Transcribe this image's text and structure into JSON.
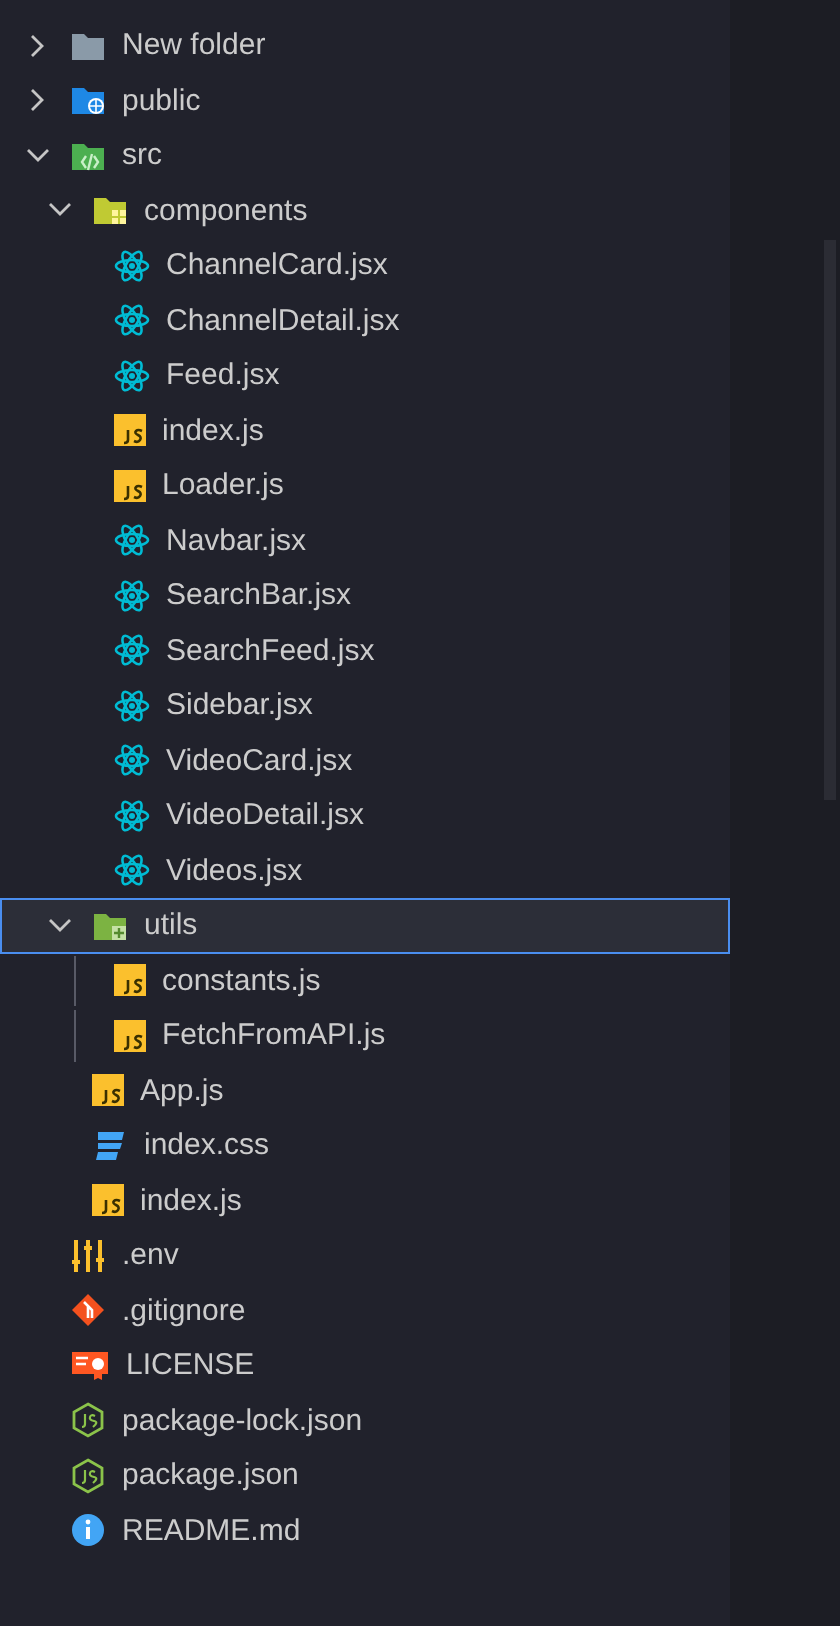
{
  "tree": [
    {
      "label": "New folder",
      "kind": "folder",
      "expanded": false,
      "selected": false
    },
    {
      "label": "public",
      "kind": "folder-public",
      "expanded": false,
      "selected": false
    },
    {
      "label": "src",
      "kind": "folder-src",
      "expanded": true,
      "selected": false,
      "children": [
        {
          "label": "components",
          "kind": "folder-components",
          "expanded": true,
          "selected": false,
          "children": [
            {
              "label": "ChannelCard.jsx",
              "kind": "react",
              "selected": false
            },
            {
              "label": "ChannelDetail.jsx",
              "kind": "react",
              "selected": false
            },
            {
              "label": "Feed.jsx",
              "kind": "react",
              "selected": false
            },
            {
              "label": "index.js",
              "kind": "js",
              "selected": false
            },
            {
              "label": "Loader.js",
              "kind": "js",
              "selected": false
            },
            {
              "label": "Navbar.jsx",
              "kind": "react",
              "selected": false
            },
            {
              "label": "SearchBar.jsx",
              "kind": "react",
              "selected": false
            },
            {
              "label": "SearchFeed.jsx",
              "kind": "react",
              "selected": false
            },
            {
              "label": "Sidebar.jsx",
              "kind": "react",
              "selected": false
            },
            {
              "label": "VideoCard.jsx",
              "kind": "react",
              "selected": false
            },
            {
              "label": "VideoDetail.jsx",
              "kind": "react",
              "selected": false
            },
            {
              "label": "Videos.jsx",
              "kind": "react",
              "selected": false
            }
          ]
        },
        {
          "label": "utils",
          "kind": "folder-utils",
          "expanded": true,
          "selected": true,
          "children": [
            {
              "label": "constants.js",
              "kind": "js",
              "selected": false
            },
            {
              "label": "FetchFromAPI.js",
              "kind": "js",
              "selected": false
            }
          ]
        },
        {
          "label": "App.js",
          "kind": "js",
          "selected": false
        },
        {
          "label": "index.css",
          "kind": "css",
          "selected": false
        },
        {
          "label": "index.js",
          "kind": "js",
          "selected": false
        }
      ]
    },
    {
      "label": ".env",
      "kind": "env",
      "selected": false
    },
    {
      "label": ".gitignore",
      "kind": "git",
      "selected": false
    },
    {
      "label": "LICENSE",
      "kind": "license",
      "selected": false
    },
    {
      "label": "package-lock.json",
      "kind": "node",
      "selected": false
    },
    {
      "label": "package.json",
      "kind": "node",
      "selected": false
    },
    {
      "label": "README.md",
      "kind": "info",
      "selected": false
    }
  ]
}
